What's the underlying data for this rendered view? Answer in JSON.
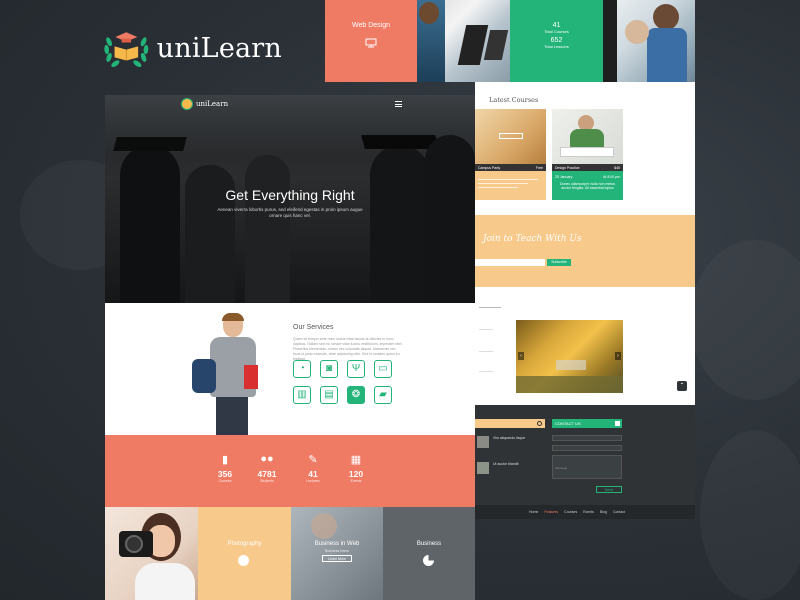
{
  "brand": {
    "name": "uniLearn",
    "colors": {
      "green": "#23b47a",
      "coral": "#ef7b64",
      "peach": "#f7c98a",
      "dark": "#2a3036"
    }
  },
  "top_tiles": {
    "web_design": {
      "label": "Web Design",
      "icon": "monitor-icon"
    },
    "courses_stat": {
      "num1": "41",
      "label1": "Total Courses",
      "num2": "652",
      "label2": "Total Lessons"
    }
  },
  "hero": {
    "logo_text": "uniLearn",
    "menu_icon": "hamburger-icon",
    "title": "Get Everything Right",
    "subtitle": "Aenean viverra lobortis purus, sed eleifend egestas in proin ipsum augue ornare quis hanc vel."
  },
  "services": {
    "title": "Our Services",
    "text": "Quam sit tempor ante nunc luctus vitae lacinia at ultricies in nunc dapibus. Nullam sed mi, ornare vitae luctus vestibulum, imperdiet nibh. Phasellus elementum, metus nec vulputate aliquet. Maecenas nec risus ut justo molestie, vitae adipiscing nibh. Sed in sodales quam eu tristique.",
    "icons": [
      "pie-chart-icon",
      "camera-icon",
      "utensils-icon",
      "monitor-icon",
      "building-icon",
      "presentation-icon",
      "aperture-icon",
      "chat-icon"
    ]
  },
  "stats": [
    {
      "icon": "book-icon",
      "num": "356",
      "label": "Courses"
    },
    {
      "icon": "users-icon",
      "num": "4781",
      "label": "Students"
    },
    {
      "icon": "pencil-icon",
      "num": "41",
      "label": "Lectures"
    },
    {
      "icon": "calendar-icon",
      "num": "120",
      "label": "Events"
    }
  ],
  "categories": [
    {
      "label": "",
      "icon": ""
    },
    {
      "label": "Photography",
      "icon": "aperture-icon"
    },
    {
      "label": "Business in Web",
      "sub": "Business lorem",
      "button": "Learn More"
    },
    {
      "label": "Business",
      "icon": "pie-chart-icon"
    }
  ],
  "right_page": {
    "latest_title": "Latest Courses",
    "courses": [
      {
        "name": "Campus Party",
        "price": "Free",
        "date": "",
        "time": "",
        "text": ""
      },
      {
        "name": "Design Practice",
        "price": "$45",
        "date": "25 January",
        "time": "At 8:00 pm",
        "text": "Donec ullamcorper nulla non metus auctor fringilla. All essential topics"
      }
    ],
    "subscribe_title": "Join to Teach With Us",
    "subscribe_button": "Subscribe",
    "footer_news_items": [
      "Vim aliquando iisque",
      "Ut auctor blandit"
    ],
    "contact_title": "CONTACT US",
    "contact_fields": [
      "Name",
      "Email",
      "Message"
    ],
    "send_button": "Send",
    "menu": [
      "Home",
      "Features",
      "Courses",
      "Events",
      "Blog",
      "Contact"
    ]
  }
}
